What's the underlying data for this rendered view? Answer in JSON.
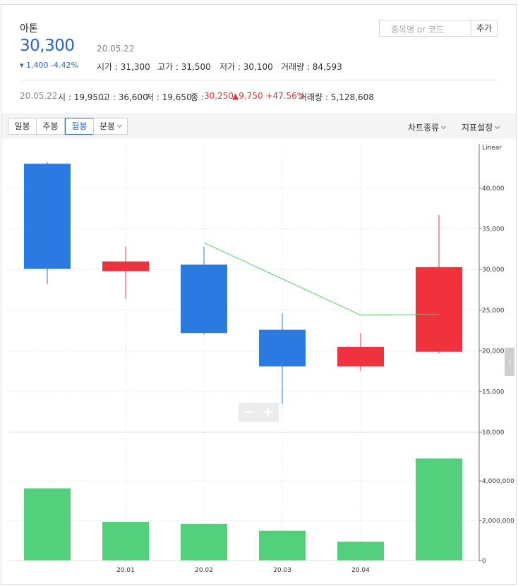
{
  "header": {
    "name": "아톤",
    "price": "30,300",
    "date": "20.05.22",
    "change": "▾ 1,400 -4.42%",
    "open_label": "시가 : 31,300",
    "high_label": "고가 : 31,500",
    "low_label": "저가 : 30,100",
    "volume_label": "거래량 : 84,593"
  },
  "search": {
    "placeholder": "종목명 or 코드",
    "add_label": "추가"
  },
  "period_row": {
    "date": "20.05.22",
    "open": "시 : 19,950",
    "high": "고 : 36,600",
    "low": "저 : 19,650",
    "close_label": "종 : ",
    "close_value": "30,250",
    "change": "▲9,750 +47.56%",
    "volume": "거래량 : 5,128,608"
  },
  "toolbar": {
    "tabs": [
      "일봉",
      "주봉",
      "월봉",
      "분봉"
    ],
    "active_tab": "월봉",
    "chart_type_label": "차트종류",
    "indicator_label": "지표설정"
  },
  "zoom": {
    "minus": "−",
    "plus": "+"
  },
  "chart_data": [
    {
      "type": "candlestick",
      "scale_label": "Linear",
      "categories": [
        "",
        "20.01",
        "20.02",
        "20.03",
        "20.04",
        ""
      ],
      "candles": [
        {
          "open": 43000,
          "high": 43200,
          "low": 28200,
          "close": 30100,
          "color": "#2a7ae2"
        },
        {
          "open": 29800,
          "high": 32800,
          "low": 26400,
          "close": 31000,
          "color": "#f0323f"
        },
        {
          "open": 30600,
          "high": 32800,
          "low": 22000,
          "close": 22200,
          "color": "#2a7ae2"
        },
        {
          "open": 22600,
          "high": 24600,
          "low": 13500,
          "close": 18100,
          "color": "#2a7ae2"
        },
        {
          "open": 18100,
          "high": 22200,
          "low": 17500,
          "close": 20500,
          "color": "#f0323f"
        },
        {
          "open": 19900,
          "high": 36700,
          "low": 19700,
          "close": 30300,
          "color": "#f0323f"
        }
      ],
      "moving_average": {
        "color": "#5ccc6e",
        "values": [
          null,
          null,
          33300,
          null,
          24400,
          24500
        ]
      },
      "y_ticks": [
        10000,
        15000,
        20000,
        25000,
        30000,
        35000,
        40000
      ],
      "y_tick_labels": [
        "10,000",
        "15,000",
        "20,000",
        "25,000",
        "30,000",
        "35,000",
        "40,000"
      ],
      "ylim": [
        10000,
        45100
      ]
    },
    {
      "type": "bar",
      "categories": [
        "",
        "20.01",
        "20.02",
        "20.03",
        "20.04",
        ""
      ],
      "values": [
        3630000,
        1950000,
        1850000,
        1500000,
        950000,
        5130000
      ],
      "color": "#52d07c",
      "y_ticks": [
        0,
        2000000,
        4000000
      ],
      "y_tick_labels": [
        "0",
        "2,000,000",
        "4,000,000"
      ],
      "ylim": [
        0,
        6200000
      ]
    }
  ]
}
